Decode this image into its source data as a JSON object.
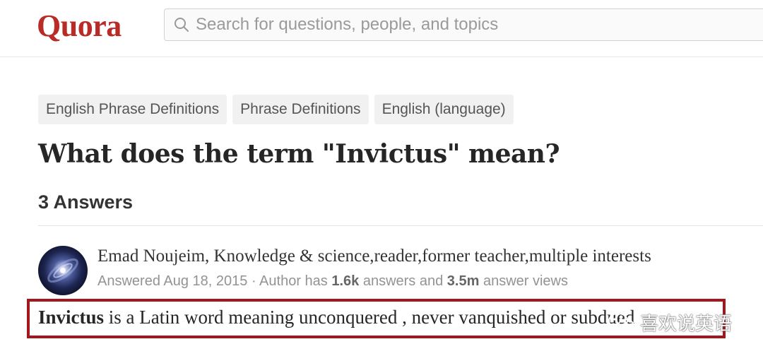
{
  "header": {
    "logo": "Quora",
    "search": {
      "placeholder": "Search for questions, people, and topics",
      "icon": "search-icon"
    }
  },
  "question": {
    "topics": [
      "English Phrase Definitions",
      "Phrase Definitions",
      "English (language)"
    ],
    "title": "What does the term \"Invictus\" mean?",
    "answer_count": "3 Answers"
  },
  "answer": {
    "author": "Emad Noujeim, Knowledge & science,reader,former teacher,multiple interests",
    "meta": {
      "prefix": "Answered Aug 18, 2015 · Author has ",
      "answers_count": "1.6k",
      "middle": " answers and ",
      "views_count": "3.5m",
      "suffix": " answer views"
    },
    "text": {
      "bold": "Invictus",
      "rest": " is a Latin word meaning unconquered , never vanquished or subdued"
    }
  },
  "watermark": {
    "text": "喜欢说英语",
    "icon": "wechat-icon"
  },
  "colors": {
    "brand": "#b92b27",
    "highlight_border": "#a3161c"
  }
}
